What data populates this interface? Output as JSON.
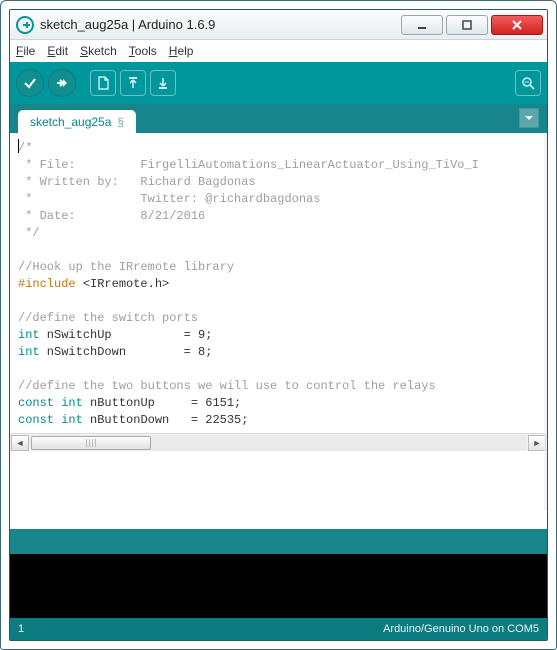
{
  "window": {
    "title": "sketch_aug25a | Arduino 1.6.9"
  },
  "menu": {
    "file": "File",
    "edit": "Edit",
    "sketch": "Sketch",
    "tools": "Tools",
    "help": "Help"
  },
  "toolbar": {
    "verify": "verify",
    "upload": "upload",
    "new": "new",
    "open": "open",
    "save": "save",
    "serial": "serial-monitor"
  },
  "tab": {
    "name": "sketch_aug25a",
    "modified": "§"
  },
  "code": {
    "lines": [
      {
        "t": "cursor-slash",
        "a": "/",
        "b": "*"
      },
      {
        "t": "gray",
        "text": " * File:         FirgelliAutomations_LinearActuator_Using_TiVo_I"
      },
      {
        "t": "gray",
        "text": " * Written by:   Richard Bagdonas"
      },
      {
        "t": "gray",
        "text": " *               Twitter: @richardbagdonas"
      },
      {
        "t": "gray",
        "text": " * Date:         8/21/2016"
      },
      {
        "t": "gray",
        "text": " */"
      },
      {
        "t": "plain",
        "text": ""
      },
      {
        "t": "gray",
        "text": "//Hook up the IRremote library"
      },
      {
        "t": "include",
        "a": "#include ",
        "b": "<IRremote.h>"
      },
      {
        "t": "plain",
        "text": ""
      },
      {
        "t": "gray",
        "text": "//define the switch ports"
      },
      {
        "t": "decl",
        "kw": "int",
        "rest": " nSwitchUp          = 9;"
      },
      {
        "t": "decl",
        "kw": "int",
        "rest": " nSwitchDown        = 8;"
      },
      {
        "t": "plain",
        "text": ""
      },
      {
        "t": "gray",
        "text": "//define the two buttons we will use to control the relays"
      },
      {
        "t": "decl2",
        "a": "const ",
        "b": "int",
        "rest": " nButtonUp     = 6151;"
      },
      {
        "t": "decl2",
        "a": "const ",
        "b": "int",
        "rest": " nButtonDown   = 22535;"
      }
    ]
  },
  "status": {
    "line": "1",
    "board": "Arduino/Genuino Uno on COM5"
  }
}
